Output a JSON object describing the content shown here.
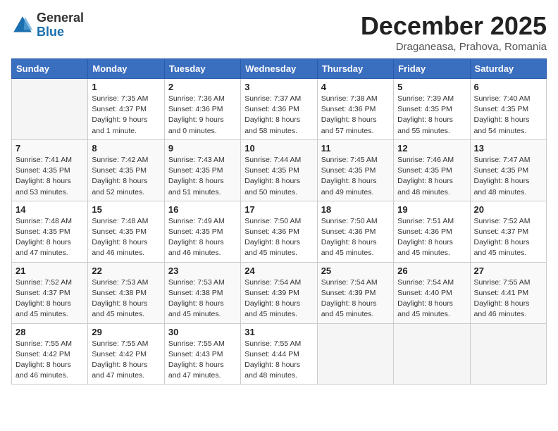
{
  "logo": {
    "general": "General",
    "blue": "Blue"
  },
  "header": {
    "month": "December 2025",
    "location": "Draganeasa, Prahova, Romania"
  },
  "days_of_week": [
    "Sunday",
    "Monday",
    "Tuesday",
    "Wednesday",
    "Thursday",
    "Friday",
    "Saturday"
  ],
  "weeks": [
    [
      {
        "day": "",
        "info": ""
      },
      {
        "day": "1",
        "info": "Sunrise: 7:35 AM\nSunset: 4:37 PM\nDaylight: 9 hours\nand 1 minute."
      },
      {
        "day": "2",
        "info": "Sunrise: 7:36 AM\nSunset: 4:36 PM\nDaylight: 9 hours\nand 0 minutes."
      },
      {
        "day": "3",
        "info": "Sunrise: 7:37 AM\nSunset: 4:36 PM\nDaylight: 8 hours\nand 58 minutes."
      },
      {
        "day": "4",
        "info": "Sunrise: 7:38 AM\nSunset: 4:36 PM\nDaylight: 8 hours\nand 57 minutes."
      },
      {
        "day": "5",
        "info": "Sunrise: 7:39 AM\nSunset: 4:35 PM\nDaylight: 8 hours\nand 55 minutes."
      },
      {
        "day": "6",
        "info": "Sunrise: 7:40 AM\nSunset: 4:35 PM\nDaylight: 8 hours\nand 54 minutes."
      }
    ],
    [
      {
        "day": "7",
        "info": "Sunrise: 7:41 AM\nSunset: 4:35 PM\nDaylight: 8 hours\nand 53 minutes."
      },
      {
        "day": "8",
        "info": "Sunrise: 7:42 AM\nSunset: 4:35 PM\nDaylight: 8 hours\nand 52 minutes."
      },
      {
        "day": "9",
        "info": "Sunrise: 7:43 AM\nSunset: 4:35 PM\nDaylight: 8 hours\nand 51 minutes."
      },
      {
        "day": "10",
        "info": "Sunrise: 7:44 AM\nSunset: 4:35 PM\nDaylight: 8 hours\nand 50 minutes."
      },
      {
        "day": "11",
        "info": "Sunrise: 7:45 AM\nSunset: 4:35 PM\nDaylight: 8 hours\nand 49 minutes."
      },
      {
        "day": "12",
        "info": "Sunrise: 7:46 AM\nSunset: 4:35 PM\nDaylight: 8 hours\nand 48 minutes."
      },
      {
        "day": "13",
        "info": "Sunrise: 7:47 AM\nSunset: 4:35 PM\nDaylight: 8 hours\nand 48 minutes."
      }
    ],
    [
      {
        "day": "14",
        "info": "Sunrise: 7:48 AM\nSunset: 4:35 PM\nDaylight: 8 hours\nand 47 minutes."
      },
      {
        "day": "15",
        "info": "Sunrise: 7:48 AM\nSunset: 4:35 PM\nDaylight: 8 hours\nand 46 minutes."
      },
      {
        "day": "16",
        "info": "Sunrise: 7:49 AM\nSunset: 4:35 PM\nDaylight: 8 hours\nand 46 minutes."
      },
      {
        "day": "17",
        "info": "Sunrise: 7:50 AM\nSunset: 4:36 PM\nDaylight: 8 hours\nand 45 minutes."
      },
      {
        "day": "18",
        "info": "Sunrise: 7:50 AM\nSunset: 4:36 PM\nDaylight: 8 hours\nand 45 minutes."
      },
      {
        "day": "19",
        "info": "Sunrise: 7:51 AM\nSunset: 4:36 PM\nDaylight: 8 hours\nand 45 minutes."
      },
      {
        "day": "20",
        "info": "Sunrise: 7:52 AM\nSunset: 4:37 PM\nDaylight: 8 hours\nand 45 minutes."
      }
    ],
    [
      {
        "day": "21",
        "info": "Sunrise: 7:52 AM\nSunset: 4:37 PM\nDaylight: 8 hours\nand 45 minutes."
      },
      {
        "day": "22",
        "info": "Sunrise: 7:53 AM\nSunset: 4:38 PM\nDaylight: 8 hours\nand 45 minutes."
      },
      {
        "day": "23",
        "info": "Sunrise: 7:53 AM\nSunset: 4:38 PM\nDaylight: 8 hours\nand 45 minutes."
      },
      {
        "day": "24",
        "info": "Sunrise: 7:54 AM\nSunset: 4:39 PM\nDaylight: 8 hours\nand 45 minutes."
      },
      {
        "day": "25",
        "info": "Sunrise: 7:54 AM\nSunset: 4:39 PM\nDaylight: 8 hours\nand 45 minutes."
      },
      {
        "day": "26",
        "info": "Sunrise: 7:54 AM\nSunset: 4:40 PM\nDaylight: 8 hours\nand 45 minutes."
      },
      {
        "day": "27",
        "info": "Sunrise: 7:55 AM\nSunset: 4:41 PM\nDaylight: 8 hours\nand 46 minutes."
      }
    ],
    [
      {
        "day": "28",
        "info": "Sunrise: 7:55 AM\nSunset: 4:42 PM\nDaylight: 8 hours\nand 46 minutes."
      },
      {
        "day": "29",
        "info": "Sunrise: 7:55 AM\nSunset: 4:42 PM\nDaylight: 8 hours\nand 47 minutes."
      },
      {
        "day": "30",
        "info": "Sunrise: 7:55 AM\nSunset: 4:43 PM\nDaylight: 8 hours\nand 47 minutes."
      },
      {
        "day": "31",
        "info": "Sunrise: 7:55 AM\nSunset: 4:44 PM\nDaylight: 8 hours\nand 48 minutes."
      },
      {
        "day": "",
        "info": ""
      },
      {
        "day": "",
        "info": ""
      },
      {
        "day": "",
        "info": ""
      }
    ]
  ]
}
